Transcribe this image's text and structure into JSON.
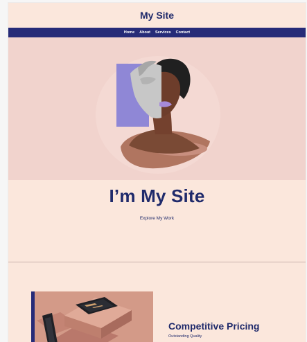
{
  "header": {
    "title": "My Site"
  },
  "nav": {
    "items": [
      {
        "label": "Home"
      },
      {
        "label": "About"
      },
      {
        "label": "Services"
      },
      {
        "label": "Contact"
      }
    ]
  },
  "hero": {
    "heading": "I’m My Site",
    "cta": "Explore My Work"
  },
  "feature": {
    "title": "Competitive Pricing",
    "subtitle": "Outstanding Quality"
  },
  "colors": {
    "page_bg": "#fbe7dc",
    "hero_bg": "#f1d3cd",
    "nav_bg": "#262b78",
    "accent_navy": "#1f2a6b",
    "accent_lavender": "#8f87d6",
    "bust_silver": "#c7c7c7",
    "product_tan": "#c88f7f"
  }
}
